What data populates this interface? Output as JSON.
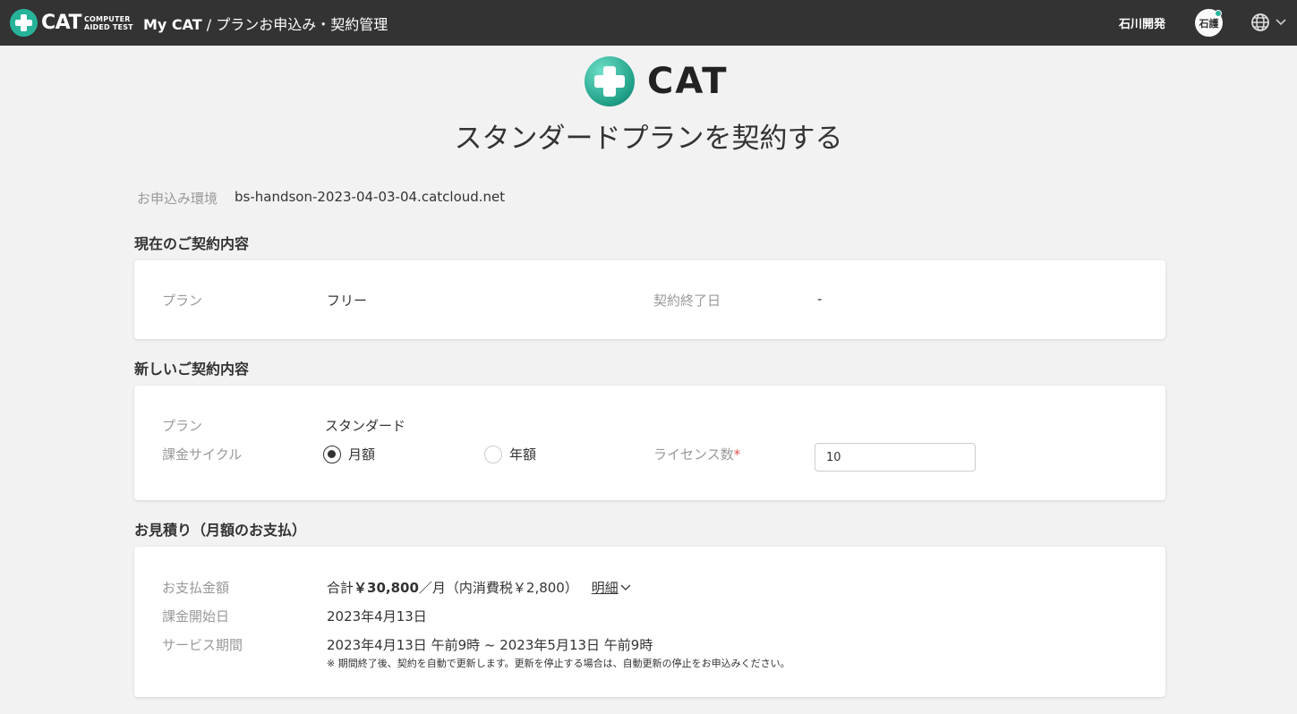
{
  "header": {
    "logo_word": "CAT",
    "logo_sub1": "COMPUTER",
    "logo_sub2": "AIDED TEST",
    "app_name": "My CAT",
    "separator": " / ",
    "page_name": "プランお申込み・契約管理",
    "user_name": "石川開発",
    "avatar_text": "石護",
    "icons": {
      "globe": "globe-icon",
      "menu": "chevron-down-icon"
    },
    "accent_color": "#26b39a"
  },
  "hero": {
    "logo_word": "CAT",
    "title": "スタンダードプランを契約する"
  },
  "environment": {
    "label": "お申込み環境",
    "value": "bs-handson-2023-04-03-04.catcloud.net"
  },
  "current_contract": {
    "section_title": "現在のご契約内容",
    "plan_label": "プラン",
    "plan_value": "フリー",
    "end_date_label": "契約終了日",
    "end_date_value": "-"
  },
  "new_contract": {
    "section_title": "新しいご契約内容",
    "plan_label": "プラン",
    "plan_value": "スタンダード",
    "cycle_label": "課金サイクル",
    "cycle_options": [
      {
        "label": "月額",
        "selected": true
      },
      {
        "label": "年額",
        "selected": false
      }
    ],
    "license_label": "ライセンス数",
    "license_required_mark": "*",
    "license_value": "10"
  },
  "estimate": {
    "section_title": "お見積り（月額のお支払）",
    "amount_label": "お支払金額",
    "amount_prefix": "合計",
    "amount_value": "￥30,800",
    "amount_suffix": "／月（内消費税￥2,800）",
    "detail_link": "明細",
    "start_label": "課金開始日",
    "start_value": "2023年4月13日",
    "period_label": "サービス期間",
    "period_value": "2023年4月13日 午前9時 ~ 2023年5月13日 午前9時",
    "note": "※ 期間終了後、契約を自動で更新します。更新を停止する場合は、自動更新の停止をお申込みください。"
  }
}
